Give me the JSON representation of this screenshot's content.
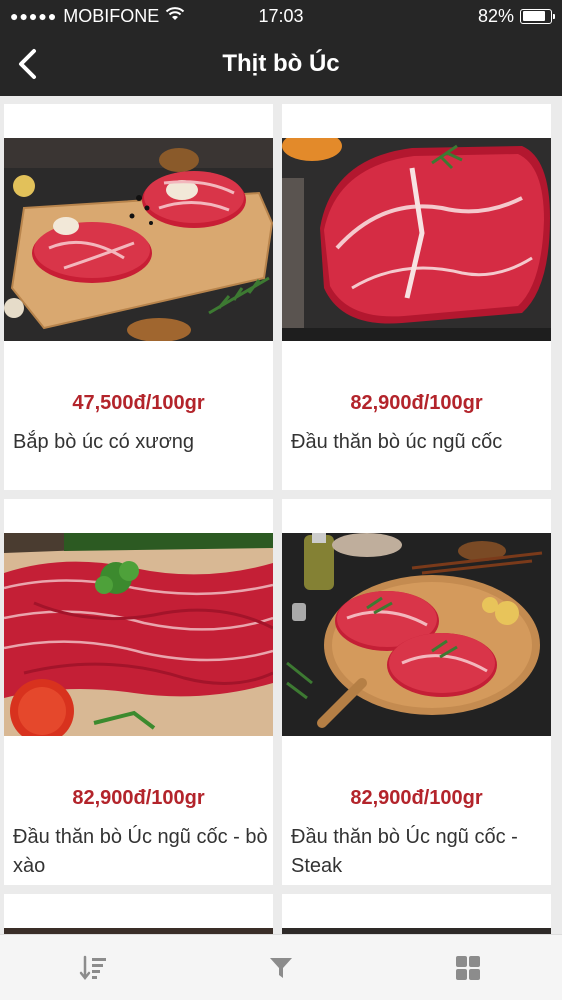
{
  "status_bar": {
    "signal": "●●●●●",
    "carrier": "MOBIFONE",
    "time": "17:03",
    "battery_text": "82%",
    "battery_level": 0.82
  },
  "nav": {
    "title": "Thịt bò Úc",
    "back_icon": "chevron-left-icon"
  },
  "products": [
    {
      "price": "47,500đ/100gr",
      "name": "Bắp bò úc có xương",
      "image": "beef-shank-slices"
    },
    {
      "price": "82,900đ/100gr",
      "name": "Đầu thăn bò úc ngũ cốc",
      "image": "beef-roast-block"
    },
    {
      "price": "82,900đ/100gr",
      "name": "Đầu thăn bò Úc ngũ cốc - bò xào",
      "image": "thin-sliced-beef"
    },
    {
      "price": "82,900đ/100gr",
      "name": "Đầu thăn bò Úc ngũ cốc - Steak",
      "image": "beef-steaks-board"
    }
  ],
  "tab_bar": {
    "items": [
      "sort-icon",
      "filter-icon",
      "grid-view-icon"
    ]
  },
  "colors": {
    "bar_background": "#262626",
    "price": "#b3242b",
    "page_background": "#ebebeb"
  }
}
